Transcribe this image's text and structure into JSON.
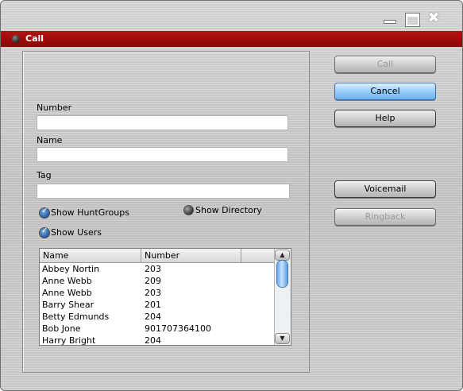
{
  "window": {
    "title": "Call",
    "controls": {
      "minimize_icon": "minimize-icon",
      "maximize_icon": "maximize-icon",
      "close_glyph": "✖"
    }
  },
  "form": {
    "number_label": "Number",
    "number_value": "",
    "name_label": "Name",
    "name_value": "",
    "tag_label": "Tag",
    "tag_value": ""
  },
  "options": {
    "show_huntgroups": {
      "label": "Show HuntGroups",
      "checked": true
    },
    "show_directory": {
      "label": "Show Directory",
      "checked": false
    },
    "show_users": {
      "label": "Show Users",
      "checked": true
    }
  },
  "directory_list": {
    "columns": [
      "Name",
      "Number"
    ],
    "rows": [
      {
        "name": "Abbey Nortin",
        "number": "203"
      },
      {
        "name": "Anne Webb",
        "number": "209"
      },
      {
        "name": "Anne Webb",
        "number": "203"
      },
      {
        "name": "Barry Shear",
        "number": "201"
      },
      {
        "name": "Betty Edmunds",
        "number": "204"
      },
      {
        "name": "Bob Jone",
        "number": "901707364100"
      },
      {
        "name": "Harry Bright",
        "number": "204"
      }
    ]
  },
  "buttons": {
    "call": {
      "label": "Call",
      "enabled": false
    },
    "cancel": {
      "label": "Cancel",
      "enabled": true
    },
    "help": {
      "label": "Help",
      "enabled": true
    },
    "voicemail": {
      "label": "Voicemail",
      "enabled": true
    },
    "ringback": {
      "label": "Ringback",
      "enabled": false
    }
  },
  "colors": {
    "titlebar": "#9e0b0b",
    "primary_button": "#98cdfa",
    "check_accent": "#245a9c"
  }
}
